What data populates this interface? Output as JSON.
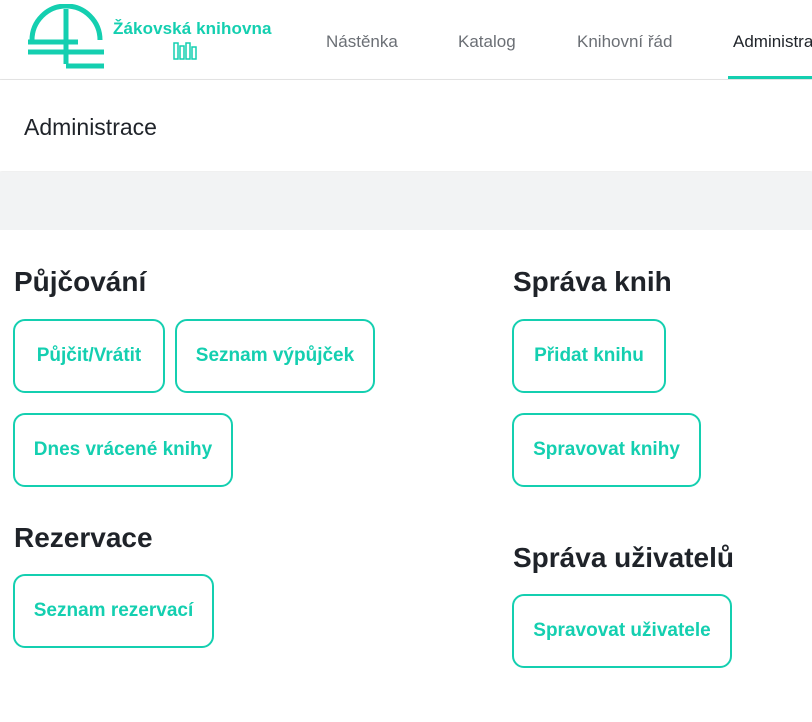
{
  "brand": {
    "name": "Žákovská knihovna",
    "logo_icon": "library-seal-logo",
    "accent_color": "#14cfb0"
  },
  "nav": {
    "items": [
      {
        "label": "Nástěnka"
      },
      {
        "label": "Katalog"
      },
      {
        "label": "Knihovní řád"
      },
      {
        "label": "Administrace",
        "active": true
      }
    ]
  },
  "page": {
    "title": "Administrace"
  },
  "sections": {
    "loans": {
      "heading": "Půjčování",
      "buttons": [
        "Půjčit/Vrátit",
        "Seznam výpůjček",
        "Dnes vrácené knihy"
      ]
    },
    "reservations": {
      "heading": "Rezervace",
      "buttons": [
        "Seznam rezervací"
      ]
    },
    "books": {
      "heading": "Správa knih",
      "buttons": [
        "Přidat knihu",
        "Spravovat knihy"
      ]
    },
    "users": {
      "heading": "Správa uživatelů",
      "buttons": [
        "Spravovat uživatele"
      ]
    }
  }
}
